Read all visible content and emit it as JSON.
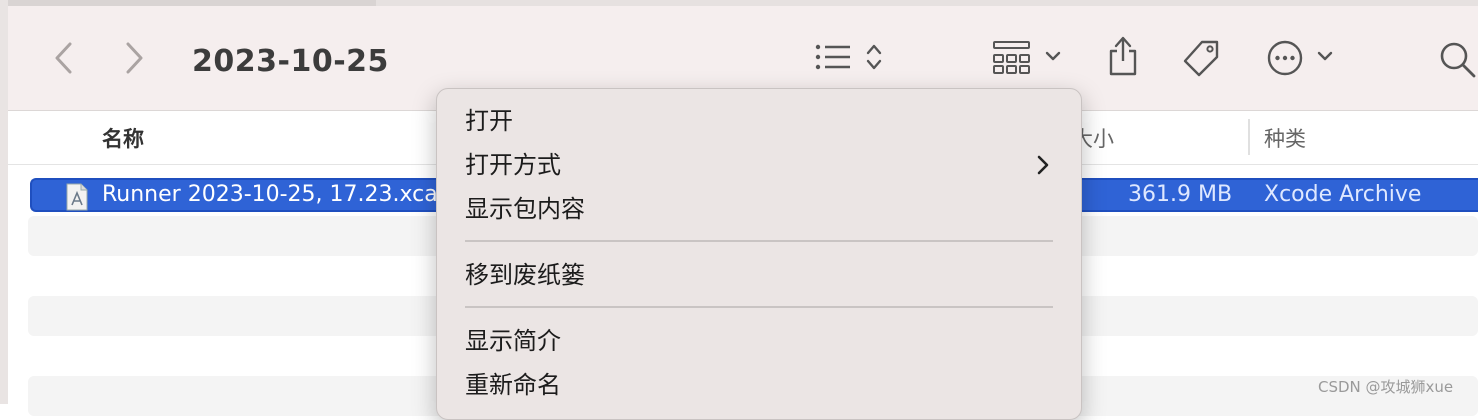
{
  "window": {
    "title": "2023-10-25"
  },
  "columns": {
    "name": "名称",
    "size": "大小",
    "kind": "种类"
  },
  "selected_file": {
    "name": "Runner 2023-10-25, 17.23.xca",
    "size": "361.9 MB",
    "kind": "Xcode Archive"
  },
  "context_menu": {
    "items": [
      "打开",
      "打开方式",
      "显示包内容",
      "移到废纸篓",
      "显示简介",
      "重新命名"
    ]
  },
  "watermark": "CSDN @攻城狮xue",
  "colors": {
    "selection": "#2f63d6",
    "menu_bg": "#ebe5e4",
    "toolbar_bg": "#f5eeee"
  }
}
